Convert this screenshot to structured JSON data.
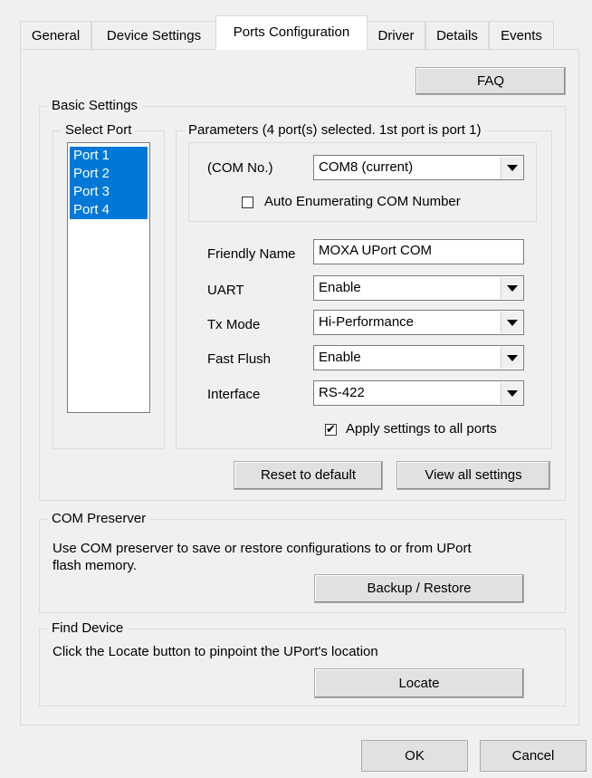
{
  "tabs": [
    {
      "label": "General",
      "active": false
    },
    {
      "label": "Device Settings",
      "active": false
    },
    {
      "label": "Ports Configuration",
      "active": true
    },
    {
      "label": "Driver",
      "active": false
    },
    {
      "label": "Details",
      "active": false
    },
    {
      "label": "Events",
      "active": false
    }
  ],
  "faq_label": "FAQ",
  "basic_settings": {
    "title": "Basic Settings",
    "select_port": {
      "title": "Select Port",
      "ports": [
        "Port 1",
        "Port 2",
        "Port 3",
        "Port 4"
      ]
    },
    "parameters": {
      "title": "Parameters (4 port(s) selected. 1st port is port 1)",
      "com_no_label": "(COM No.)",
      "com_no_value": "COM8 (current)",
      "auto_enum_label": "Auto Enumerating COM Number",
      "auto_enum_checked": false,
      "friendly_name_label": "Friendly Name",
      "friendly_name_value": "MOXA UPort COM",
      "uart_label": "UART",
      "uart_value": "Enable",
      "tx_mode_label": "Tx Mode",
      "tx_mode_value": "Hi-Performance",
      "fast_flush_label": "Fast Flush",
      "fast_flush_value": "Enable",
      "interface_label": "Interface",
      "interface_value": "RS-422",
      "apply_all_label": "Apply settings to all ports",
      "apply_all_checked": true,
      "apply_all_mark": "✔"
    },
    "reset_label": "Reset to default",
    "view_all_label": "View all settings"
  },
  "com_preserver": {
    "title": "COM Preserver",
    "description_line1": "Use COM preserver to save or restore configurations to or from UPort",
    "description_line2": "flash memory.",
    "backup_label": "Backup / Restore"
  },
  "find_device": {
    "title": "Find Device",
    "description": "Click the Locate button to pinpoint the UPort's location",
    "locate_label": "Locate"
  },
  "footer": {
    "ok_label": "OK",
    "cancel_label": "Cancel"
  },
  "colors": {
    "selection": "#0078d7",
    "panel_bg": "#f0f0f0",
    "active_tab_bg": "#ffffff"
  }
}
